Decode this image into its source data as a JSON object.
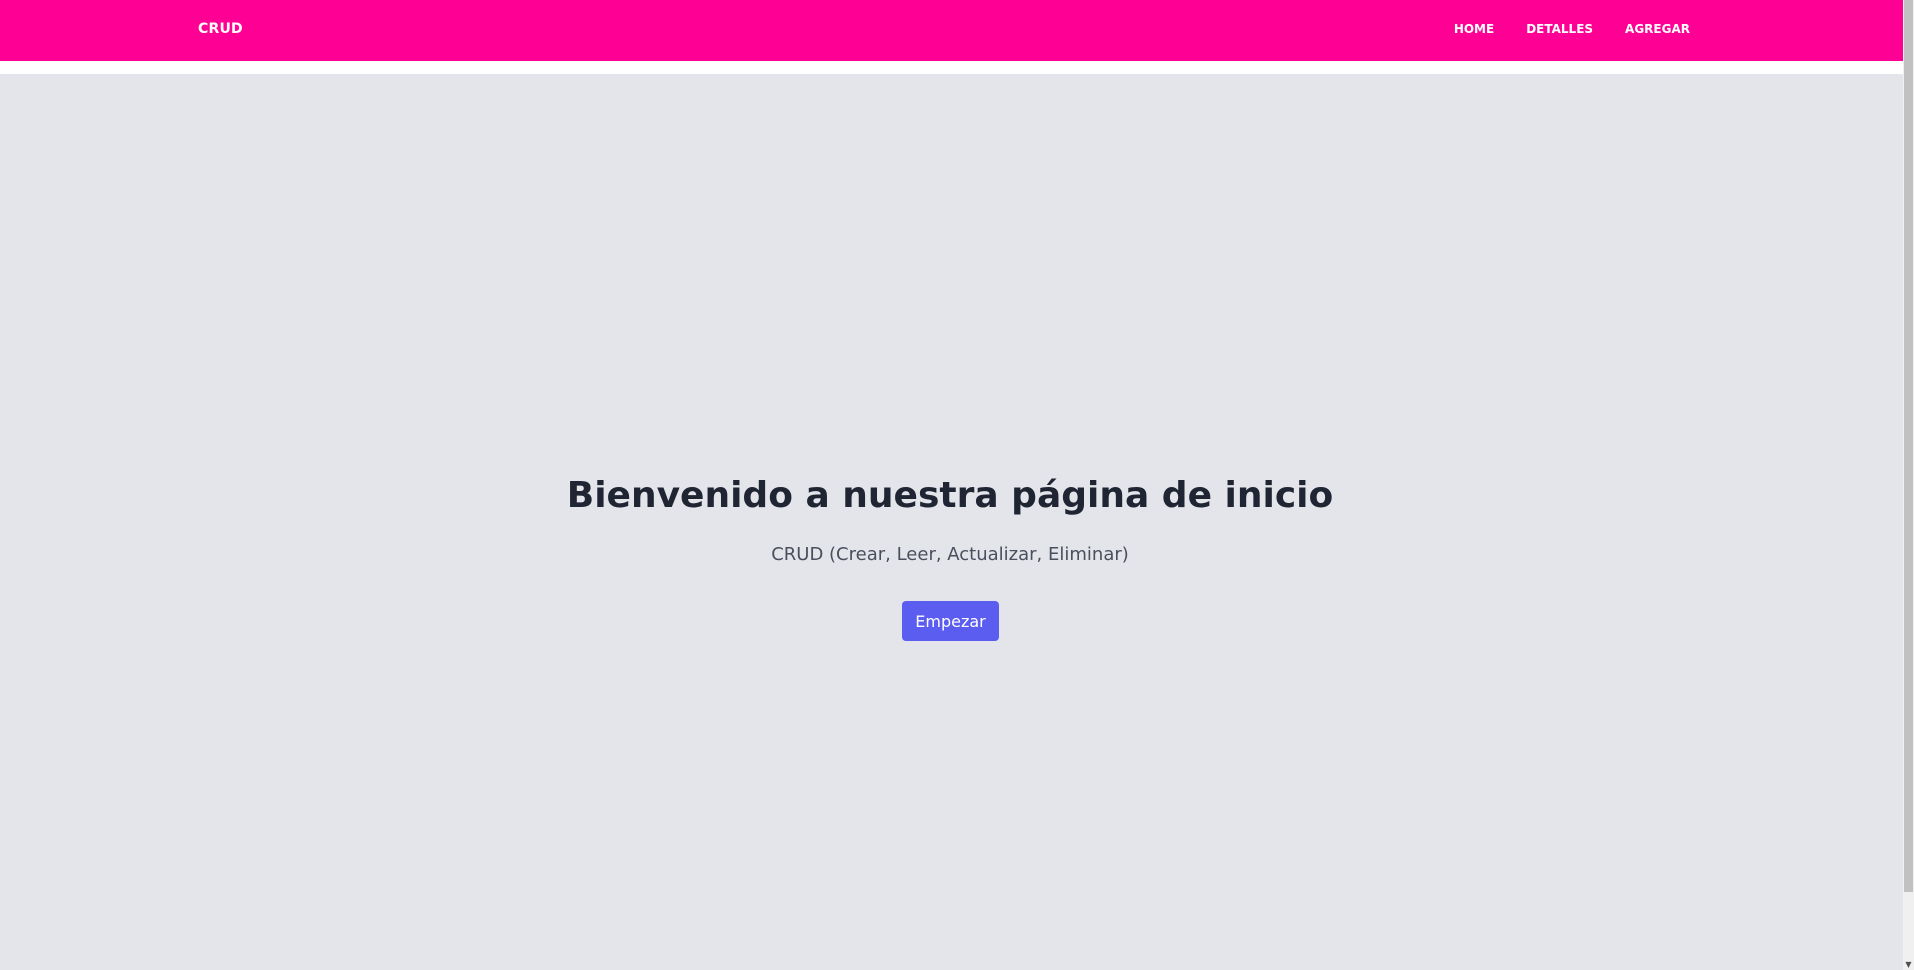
{
  "navbar": {
    "brand": "CRUD",
    "links": [
      "HOME",
      "DETALLES",
      "AGREGAR"
    ],
    "background": "#ff0095"
  },
  "hero": {
    "title": "Bienvenido a nuestra página de inicio",
    "subtitle": "CRUD (Crear, Leer, Actualizar, Eliminar)",
    "button_label": "Empezar",
    "background": "#e4e5eb",
    "button_color": "#5b5cf0"
  },
  "scrollbar": {
    "down_arrow_icon": "chevron-down-icon"
  }
}
